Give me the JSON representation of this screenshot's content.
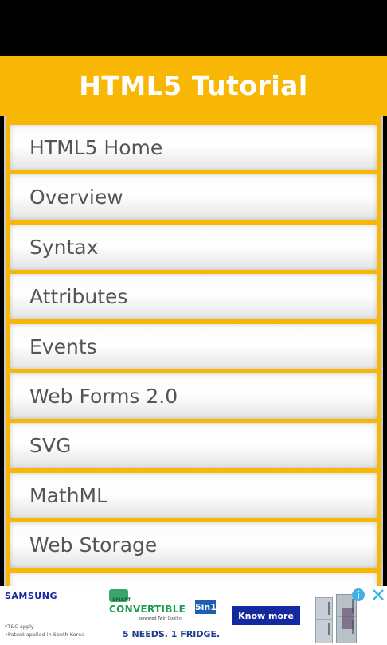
{
  "app": {
    "title": "HTML5 Tutorial"
  },
  "menu": {
    "items": [
      {
        "label": "HTML5 Home"
      },
      {
        "label": "Overview"
      },
      {
        "label": "Syntax"
      },
      {
        "label": "Attributes"
      },
      {
        "label": "Events"
      },
      {
        "label": "Web Forms 2.0"
      },
      {
        "label": "SVG"
      },
      {
        "label": "MathML"
      },
      {
        "label": "Web Storage"
      }
    ]
  },
  "ad": {
    "brand": "SAMSUNG",
    "badge_small": "SMART",
    "product": "CONVERTIBLE",
    "product_tag": "5in1",
    "product_sub": "powered Twin Cooling",
    "cta": "Know more",
    "headline": "5 NEEDS. 1 FRIDGE.",
    "note_1": "*T&C apply",
    "note_2": "•Patent applied in South Korea",
    "colors": {
      "brand": "#1428a0",
      "accent": "#1d9d55"
    },
    "icons": [
      "info-icon",
      "close-icon"
    ]
  },
  "colors": {
    "header": "#f8b705",
    "item_text": "#555555"
  }
}
